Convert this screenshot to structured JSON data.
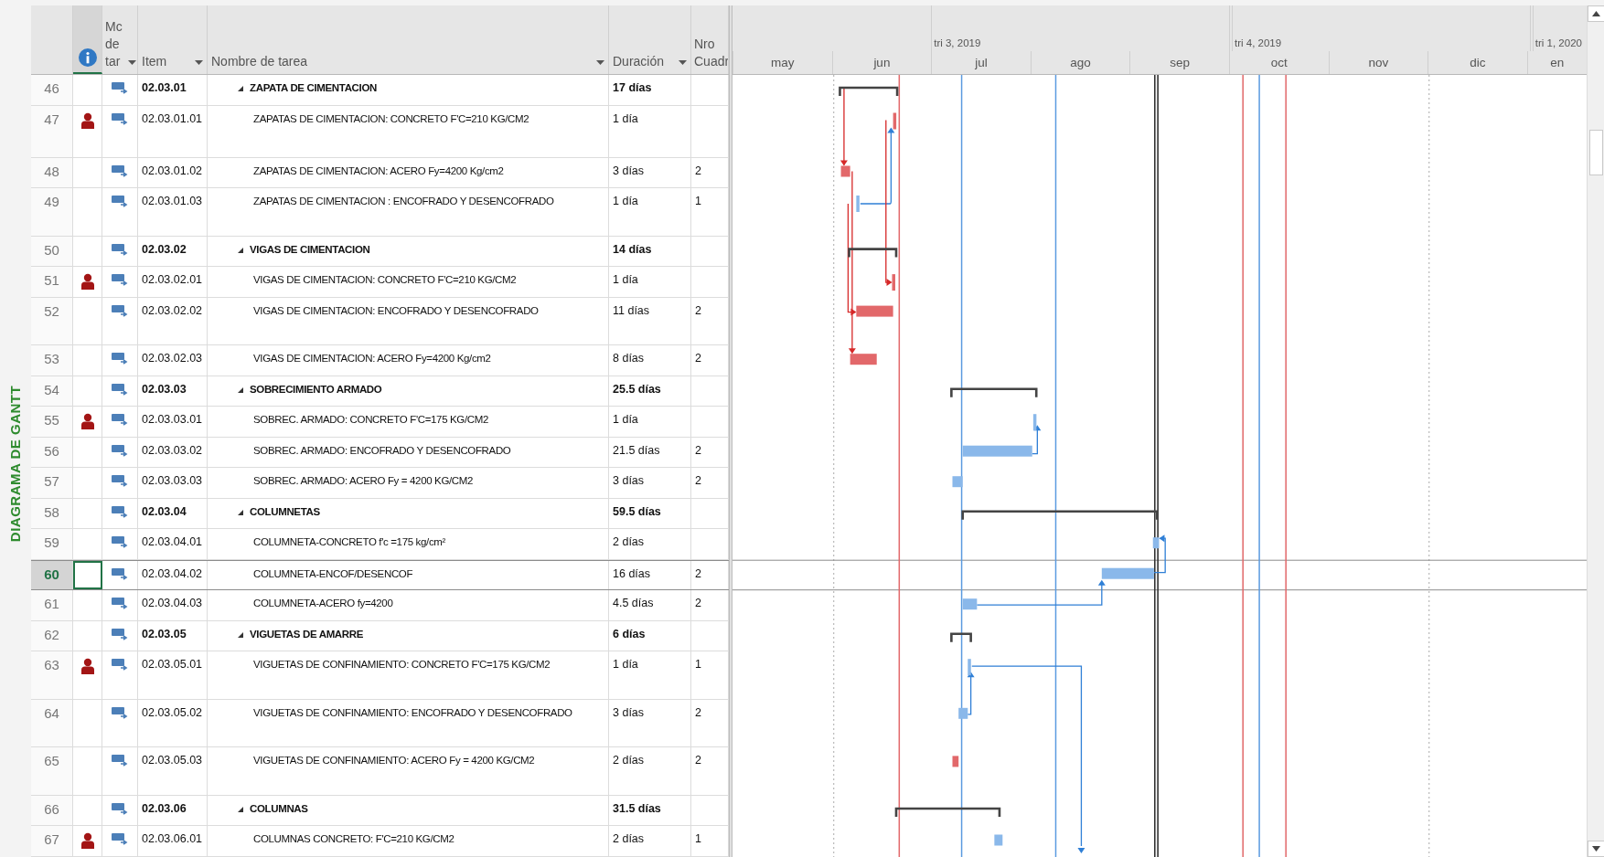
{
  "view_label": "DIAGRAMA DE GANTT",
  "columns": {
    "mode": [
      "Mc",
      "de",
      "tar"
    ],
    "item": "Item",
    "name": "Nombre de tarea",
    "duration": "Duración",
    "nro": [
      "Nro",
      "Cuadr"
    ]
  },
  "timescale": {
    "months": [
      {
        "label": "may"
      },
      {
        "label": "jun"
      },
      {
        "label": "jul",
        "quarter": "tri 3, 2019"
      },
      {
        "label": "ago"
      },
      {
        "label": "sep"
      },
      {
        "label": "oct",
        "quarter": "tri 4, 2019"
      },
      {
        "label": "nov"
      },
      {
        "label": "dic"
      },
      {
        "label": "en",
        "quarter": "tri 1, 2020"
      }
    ]
  },
  "rows": [
    {
      "id": "46",
      "kind": "summary",
      "indicator": false,
      "item": "02.03.01",
      "name": "ZAPATA DE CIMENTACION",
      "duration": "17 días",
      "expanded": true,
      "selected": false
    },
    {
      "id": "47",
      "kind": "task",
      "indicator": true,
      "item": "02.03.01.01",
      "name": "ZAPATAS DE CIMENTACION: CONCRETO F'C=210 KG/CM2",
      "duration": "1 día",
      "critical": true,
      "selected": false
    },
    {
      "id": "48",
      "kind": "task",
      "indicator": false,
      "item": "02.03.01.02",
      "name": "ZAPATAS DE CIMENTACION: ACERO Fy=4200 Kg/cm2",
      "duration": "3 días",
      "nro": "2",
      "critical": true,
      "selected": false
    },
    {
      "id": "49",
      "kind": "task",
      "indicator": false,
      "item": "02.03.01.03",
      "name": "ZAPATAS DE CIMENTACION : ENCOFRADO Y DESENCOFRADO",
      "duration": "1 día",
      "nro": "1",
      "critical": false,
      "selected": false
    },
    {
      "id": "50",
      "kind": "summary",
      "indicator": false,
      "item": "02.03.02",
      "name": "VIGAS DE CIMENTACION",
      "duration": "14 días",
      "expanded": true,
      "selected": false
    },
    {
      "id": "51",
      "kind": "task",
      "indicator": true,
      "item": "02.03.02.01",
      "name": "VIGAS DE CIMENTACION: CONCRETO F'C=210 KG/CM2",
      "duration": "1 día",
      "critical": true,
      "selected": false
    },
    {
      "id": "52",
      "kind": "task",
      "indicator": false,
      "item": "02.03.02.02",
      "name": "VIGAS DE CIMENTACION: ENCOFRADO Y DESENCOFRADO",
      "duration": "11 días",
      "nro": "2",
      "critical": true,
      "selected": false
    },
    {
      "id": "53",
      "kind": "task",
      "indicator": false,
      "item": "02.03.02.03",
      "name": "VIGAS DE CIMENTACION: ACERO Fy=4200 Kg/cm2",
      "duration": "8 días",
      "nro": "2",
      "critical": true,
      "selected": false
    },
    {
      "id": "54",
      "kind": "summary",
      "indicator": false,
      "item": "02.03.03",
      "name": "SOBRECIMIENTO ARMADO",
      "duration": "25.5 días",
      "expanded": true,
      "selected": false
    },
    {
      "id": "55",
      "kind": "task",
      "indicator": true,
      "item": "02.03.03.01",
      "name": "SOBREC. ARMADO: CONCRETO F'C=175 KG/CM2",
      "duration": "1 día",
      "critical": false,
      "selected": false
    },
    {
      "id": "56",
      "kind": "task",
      "indicator": false,
      "item": "02.03.03.02",
      "name": "SOBREC. ARMADO: ENCOFRADO Y DESENCOFRADO",
      "duration": "21.5 días",
      "nro": "2",
      "critical": false,
      "selected": false
    },
    {
      "id": "57",
      "kind": "task",
      "indicator": false,
      "item": "02.03.03.03",
      "name": "SOBREC. ARMADO: ACERO Fy = 4200 KG/CM2",
      "duration": "3 días",
      "nro": "2",
      "critical": false,
      "selected": false
    },
    {
      "id": "58",
      "kind": "summary",
      "indicator": false,
      "item": "02.03.04",
      "name": "COLUMNETAS",
      "duration": "59.5 días",
      "expanded": true,
      "selected": false
    },
    {
      "id": "59",
      "kind": "task",
      "indicator": false,
      "item": "02.03.04.01",
      "name": "COLUMNETA-CONCRETO f'c =175 kg/cm²",
      "duration": "2 días",
      "critical": false,
      "selected": false
    },
    {
      "id": "60",
      "kind": "task",
      "indicator": false,
      "item": "02.03.04.02",
      "name": "COLUMNETA-ENCOF/DESENCOF",
      "duration": "16 días",
      "nro": "2",
      "critical": false,
      "selected": true
    },
    {
      "id": "61",
      "kind": "task",
      "indicator": false,
      "item": "02.03.04.03",
      "name": "COLUMNETA-ACERO fy=4200",
      "duration": "4.5 días",
      "nro": "2",
      "critical": false,
      "selected": false
    },
    {
      "id": "62",
      "kind": "summary",
      "indicator": false,
      "item": "02.03.05",
      "name": "VIGUETAS DE AMARRE",
      "duration": "6 días",
      "expanded": true,
      "selected": false
    },
    {
      "id": "63",
      "kind": "task",
      "indicator": true,
      "item": "02.03.05.01",
      "name": "VIGUETAS DE CONFINAMIENTO: CONCRETO F'C=175 KG/CM2",
      "duration": "1 día",
      "nro": "1",
      "critical": false,
      "selected": false
    },
    {
      "id": "64",
      "kind": "task",
      "indicator": false,
      "item": "02.03.05.02",
      "name": "VIGUETAS DE CONFINAMIENTO: ENCOFRADO Y DESENCOFRADO",
      "duration": "3 días",
      "nro": "2",
      "critical": false,
      "selected": false
    },
    {
      "id": "65",
      "kind": "task",
      "indicator": false,
      "item": "02.03.05.03",
      "name": "VIGUETAS DE CONFINAMIENTO: ACERO Fy = 4200 KG/CM2",
      "duration": "2 días",
      "nro": "2",
      "critical": true,
      "selected": false
    },
    {
      "id": "66",
      "kind": "summary",
      "indicator": false,
      "item": "02.03.06",
      "name": "COLUMNAS",
      "duration": "31.5 días",
      "expanded": true,
      "selected": false
    },
    {
      "id": "67",
      "kind": "task",
      "indicator": true,
      "item": "02.03.06.01",
      "name": "COLUMNAS CONCRETO: F'C=210 KG/CM2",
      "duration": "2 días",
      "nro": "1",
      "critical": false,
      "selected": false
    }
  ]
}
